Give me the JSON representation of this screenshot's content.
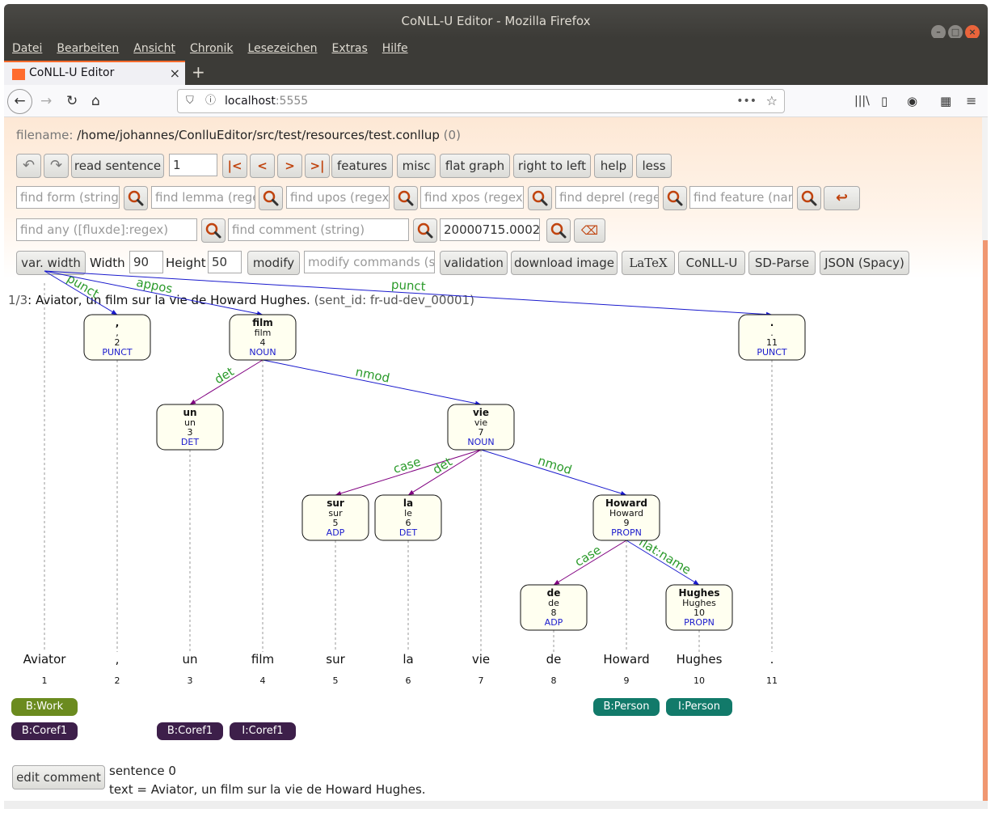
{
  "window": {
    "title": "CoNLL-U Editor - Mozilla Firefox"
  },
  "menu": [
    "Datei",
    "Bearbeiten",
    "Ansicht",
    "Chronik",
    "Lesezeichen",
    "Extras",
    "Hilfe"
  ],
  "tab": {
    "title": "CoNLL-U Editor",
    "close": "×",
    "new": "+"
  },
  "url": {
    "host": "localhost",
    "port": ":5555"
  },
  "editor": {
    "filename_label": "filename:",
    "filename_path": "/home/johannes/ConlluEditor/src/test/resources/test.conllup",
    "filename_count": "(0)",
    "row1": {
      "read": "read sentence",
      "sentence_no": "1",
      "features": "features",
      "misc": "misc",
      "flat": "flat graph",
      "rtl": "right to left",
      "help": "help",
      "less": "less"
    },
    "row2": {
      "form": "find form (string)",
      "lemma": "find lemma (regex",
      "upos": "find upos (regex/.",
      "xpos": "find xpos (regex/.",
      "deprel": "find deprel (regex",
      "feature": "find feature (name"
    },
    "row3": {
      "any": "find any ([fluxde]:regex)",
      "comment": "find comment (string)",
      "sentid": "20000715.0002"
    },
    "row4": {
      "varwidth": "var. width",
      "width_label": "Width",
      "width_value": "90",
      "height_label": "Height",
      "height_value": "50",
      "modify": "modify",
      "modify_ph": "modify commands (see",
      "validation": "validation",
      "download": "download image",
      "latex": "LaTeX",
      "conllu": "CoNLL-U",
      "sdparse": "SD-Parse",
      "json": "JSON (Spacy)"
    },
    "sentence": {
      "index": "1/3",
      "text": ": Aviator, un film sur la vie de Howard Hughes.",
      "sent_id": "(sent_id: fr-ud-dev_00001)"
    },
    "comment_button": "edit comment",
    "comment_lines": [
      "sentence 0",
      "text = Aviator, un film sur la vie de Howard Hughes."
    ]
  },
  "tree": {
    "tokens": [
      {
        "form": "Aviator",
        "id": "1"
      },
      {
        "form": ",",
        "lemma": ",",
        "id": "2",
        "upos": "PUNCT",
        "box": true
      },
      {
        "form": "un",
        "lemma": "un",
        "id": "3",
        "upos": "DET",
        "box": true
      },
      {
        "form": "film",
        "lemma": "film",
        "id": "4",
        "upos": "NOUN",
        "box": true
      },
      {
        "form": "sur",
        "lemma": "sur",
        "id": "5",
        "upos": "ADP",
        "box": true
      },
      {
        "form": "la",
        "lemma": "le",
        "id": "6",
        "upos": "DET",
        "box": true
      },
      {
        "form": "vie",
        "lemma": "vie",
        "id": "7",
        "upos": "NOUN",
        "box": true
      },
      {
        "form": "de",
        "lemma": "de",
        "id": "8",
        "upos": "ADP",
        "box": true
      },
      {
        "form": "Howard",
        "lemma": "Howard",
        "id": "9",
        "upos": "PROPN",
        "box": true
      },
      {
        "form": "Hughes",
        "lemma": "Hughes",
        "id": "10",
        "upos": "PROPN",
        "box": true
      },
      {
        "form": ".",
        "lemma": ".",
        "id": "11",
        "upos": "PUNCT",
        "box": true
      }
    ],
    "edges": [
      {
        "label": "punct",
        "from": "1",
        "to": "2",
        "color": "#1a1acd"
      },
      {
        "label": "appos",
        "from": "1",
        "to": "4",
        "color": "#1a1acd"
      },
      {
        "label": "punct",
        "from": "1",
        "to": "11",
        "color": "#1a1acd"
      },
      {
        "label": "det",
        "from": "4",
        "to": "3",
        "color": "#800080"
      },
      {
        "label": "nmod",
        "from": "4",
        "to": "7",
        "color": "#1a1acd"
      },
      {
        "label": "case",
        "from": "7",
        "to": "5",
        "color": "#800080"
      },
      {
        "label": "det",
        "from": "7",
        "to": "6",
        "color": "#800080"
      },
      {
        "label": "nmod",
        "from": "7",
        "to": "9",
        "color": "#1a1acd"
      },
      {
        "label": "case",
        "from": "9",
        "to": "8",
        "color": "#800080"
      },
      {
        "label": "flat:name",
        "from": "9",
        "to": "10",
        "color": "#1a1acd"
      }
    ],
    "tags": [
      {
        "label": "B:Work",
        "color": "#6b8b1f"
      },
      {
        "label": "B:Person",
        "color": "#127a6a"
      },
      {
        "label": "I:Person",
        "color": "#127a6a"
      },
      {
        "label": "B:Coref1",
        "color": "#3d1f4a"
      },
      {
        "label": "B:Coref1",
        "color": "#3d1f4a"
      },
      {
        "label": "I:Coref1",
        "color": "#3d1f4a"
      }
    ]
  }
}
